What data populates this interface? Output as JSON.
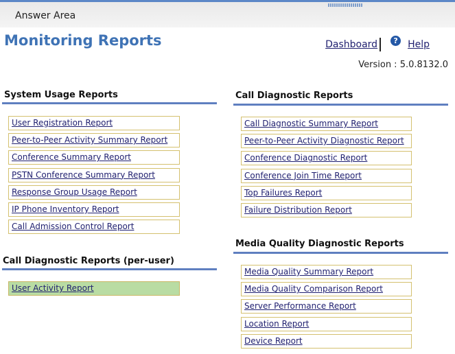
{
  "answer_area": {
    "title": "Answer Area"
  },
  "header": {
    "title": "Monitoring Reports",
    "dashboard_link": "Dashboard",
    "help_link": "Help",
    "version": "Version : 5.0.8132.0"
  },
  "sections": {
    "system_usage": {
      "title": "System Usage Reports",
      "items": [
        "User Registration Report",
        "Peer-to-Peer Activity Summary Report",
        "Conference Summary Report",
        "PSTN Conference Summary Report",
        "Response Group Usage Report",
        "IP Phone Inventory Report",
        "Call Admission Control Report"
      ]
    },
    "per_user": {
      "title": "Call Diagnostic Reports (per-user)",
      "items": [
        "User Activity Report"
      ],
      "selected_item": "User Activity Report"
    },
    "call_diagnostic": {
      "title": "Call Diagnostic Reports",
      "items": [
        "Call Diagnostic Summary Report",
        "Peer-to-Peer Activity Diagnostic Report",
        "Conference Diagnostic Report",
        "Conference Join Time Report",
        "Top Failures Report",
        "Failure Distribution Report"
      ]
    },
    "media_quality": {
      "title": "Media Quality Diagnostic Reports",
      "items": [
        "Media Quality Summary Report",
        "Media Quality Comparison Report",
        "Server Performance Report",
        "Location Report",
        "Device Report"
      ]
    }
  },
  "colors": {
    "title_blue": "#3f73b5",
    "rule_blue": "#5f7fc0",
    "item_border": "#d4c06e",
    "selected_fill": "#b9dca3",
    "link": "#1f1f6f"
  }
}
